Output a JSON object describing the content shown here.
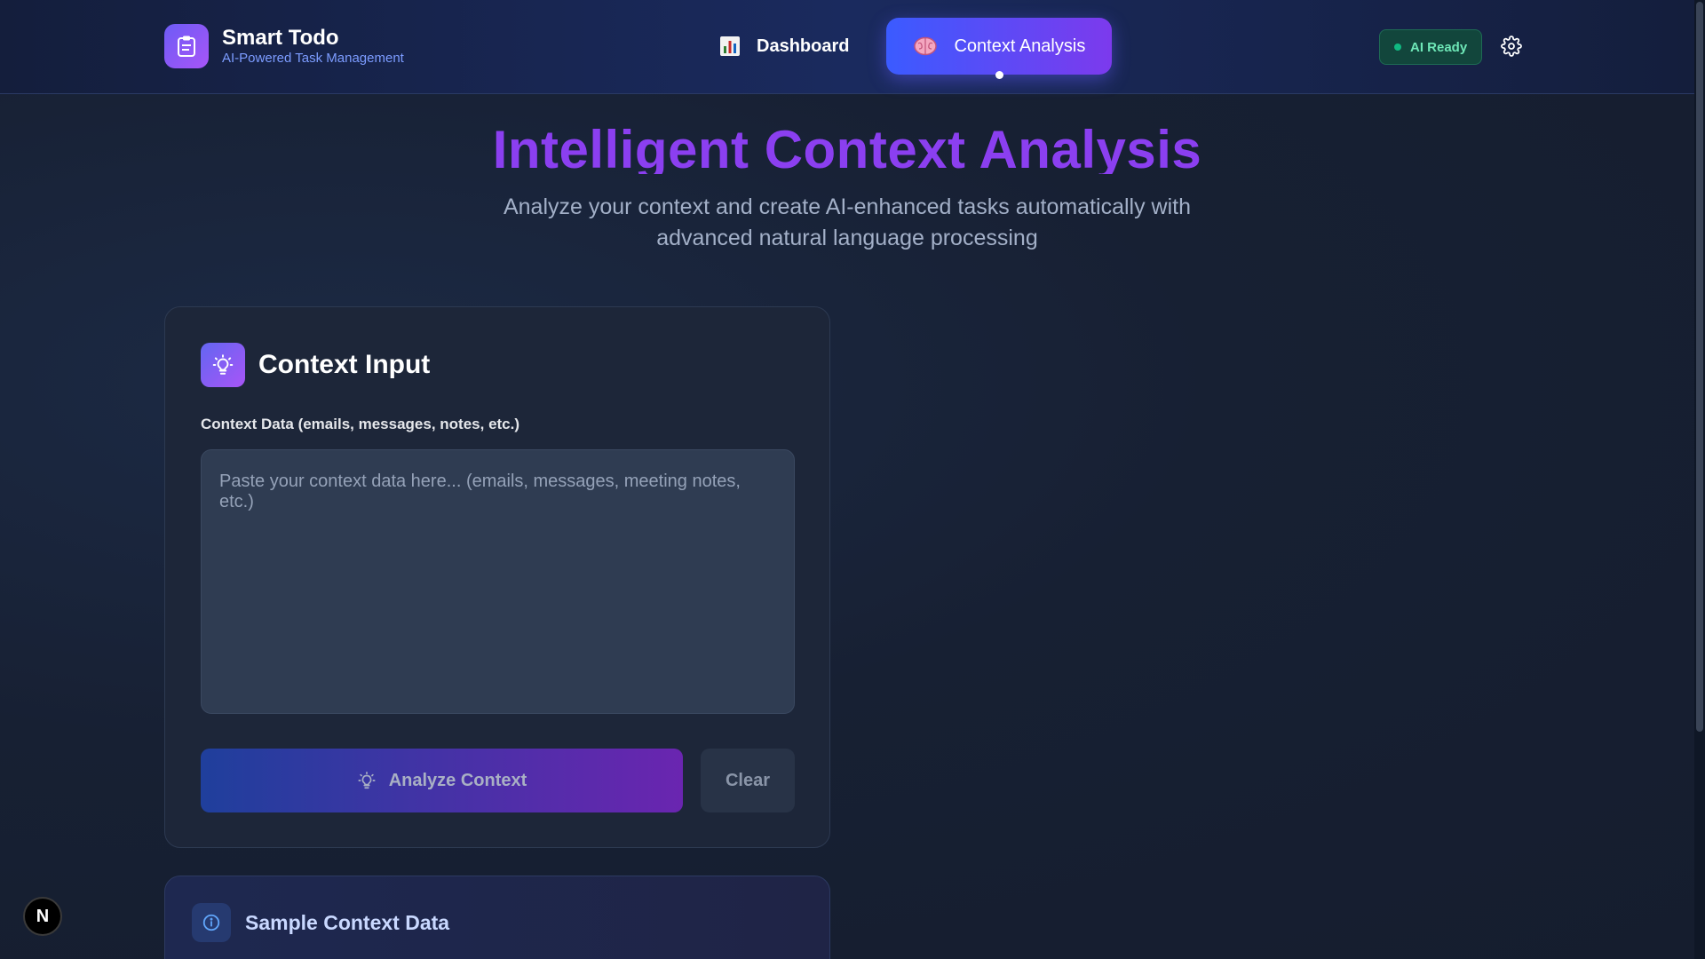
{
  "brand": {
    "title": "Smart Todo",
    "subtitle": "AI-Powered Task Management",
    "logo_icon": "clipboard-icon"
  },
  "nav": {
    "items": [
      {
        "label": "Dashboard",
        "icon": "bar-chart-icon",
        "active": false
      },
      {
        "label": "Context Analysis",
        "icon": "brain-icon",
        "active": true
      }
    ]
  },
  "status": {
    "ai_badge": "AI Ready",
    "color": "#10b981"
  },
  "hero": {
    "title": "Intelligent Context Analysis",
    "subtitle": "Analyze your context and create AI-enhanced tasks automatically with advanced natural language processing"
  },
  "context_card": {
    "title": "Context Input",
    "icon": "lightbulb-icon",
    "field_label": "Context Data (emails, messages, notes, etc.)",
    "textarea_value": "",
    "textarea_placeholder": "Paste your context data here... (emails, messages, meeting notes, etc.)",
    "analyze_label": "Analyze Context",
    "clear_label": "Clear"
  },
  "sample_card": {
    "title": "Sample Context Data",
    "icon": "info-icon"
  },
  "dev_badge": {
    "label": "N"
  },
  "colors": {
    "accent_gradient_start": "#3b5bff",
    "accent_gradient_end": "#7c3aed",
    "hero_title": "#8b3ff0"
  }
}
